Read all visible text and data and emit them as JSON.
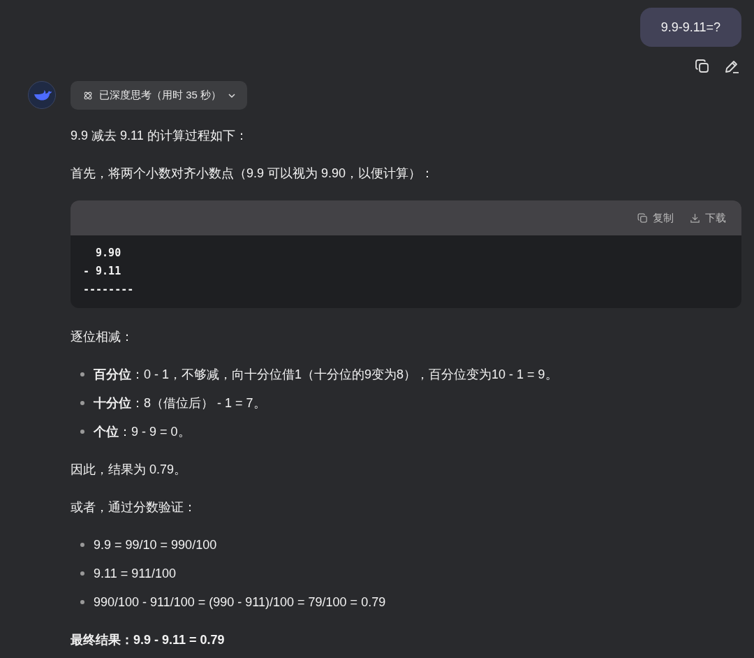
{
  "user_message": {
    "text": "9.9-9.11=?"
  },
  "thinking": {
    "label": "已深度思考（用时 35 秒）"
  },
  "answer": [
    {
      "kind": "paragraph",
      "text": "9.9 减去 9.11 的计算过程如下："
    },
    {
      "kind": "paragraph",
      "text": "首先，将两个小数对齐小数点（9.9 可以视为 9.90，以便计算）："
    },
    {
      "kind": "code",
      "actions": [
        "复制",
        "下载"
      ],
      "lines": [
        "  9.90",
        "- 9.11",
        "--------"
      ]
    },
    {
      "kind": "paragraph",
      "text": "逐位相减："
    },
    {
      "kind": "list",
      "items": [
        "**百分位**：0 - 1，不够减，向十分位借1（十分位的9变为8），百分位变为10 - 1 = 9。",
        "**十分位**：8（借位后） - 1 = 7。",
        "**个位**：9 - 9 = 0。"
      ]
    },
    {
      "kind": "paragraph",
      "text": "因此，结果为 0.79。"
    },
    {
      "kind": "paragraph",
      "text": "或者，通过分数验证："
    },
    {
      "kind": "list",
      "items": [
        "9.9 = 99/10 = 990/100",
        "9.11 = 911/100",
        "990/100 - 911/100 = (990 - 911)/100 = 79/100 = 0.79"
      ]
    },
    {
      "kind": "strong",
      "text": "最终结果：9.9 - 9.11 = 0.79"
    }
  ]
}
